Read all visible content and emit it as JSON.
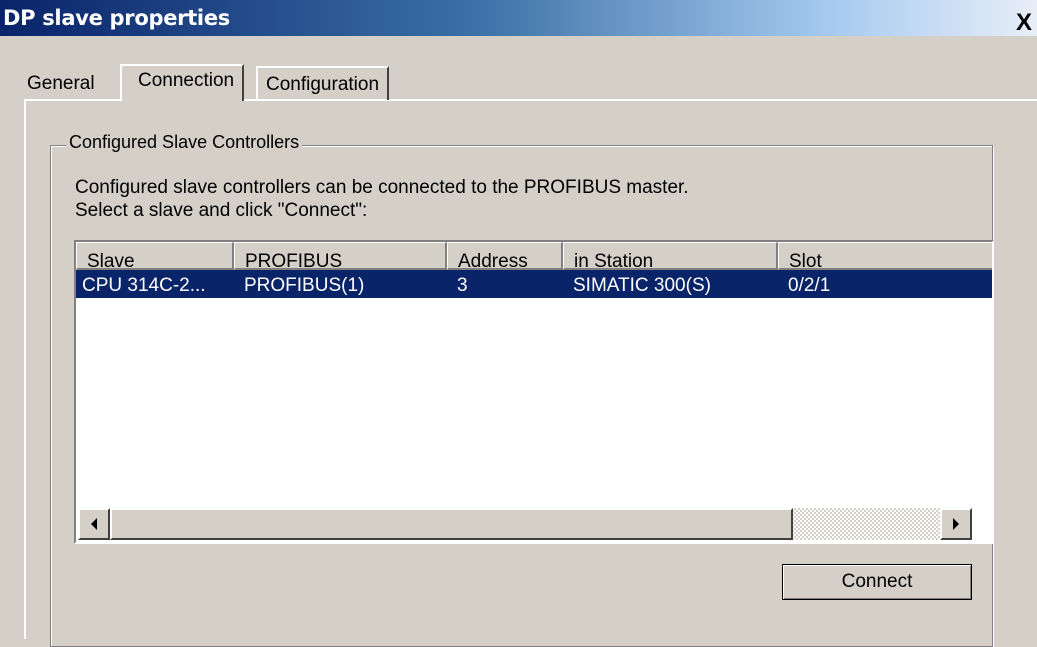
{
  "window": {
    "title": "DP slave properties",
    "close_glyph": "X"
  },
  "tabs": [
    {
      "label": "General"
    },
    {
      "label": "Connection"
    },
    {
      "label": "Configuration"
    }
  ],
  "group": {
    "legend": "Configured Slave Controllers",
    "desc_line1": "Configured slave controllers can be connected to the PROFIBUS master.",
    "desc_line2": "Select a slave and click \"Connect\":"
  },
  "table": {
    "columns": [
      "Slave",
      "PROFIBUS",
      "Address",
      "in Station",
      "Slot"
    ],
    "rows": [
      [
        "CPU 314C-2...",
        "PROFIBUS(1)",
        "3",
        "SIMATIC 300(S)",
        "0/2/1"
      ]
    ]
  },
  "buttons": {
    "connect": "Connect"
  },
  "colors": {
    "selection": "#0a246a",
    "dialog_bg": "#d4d0c8"
  }
}
